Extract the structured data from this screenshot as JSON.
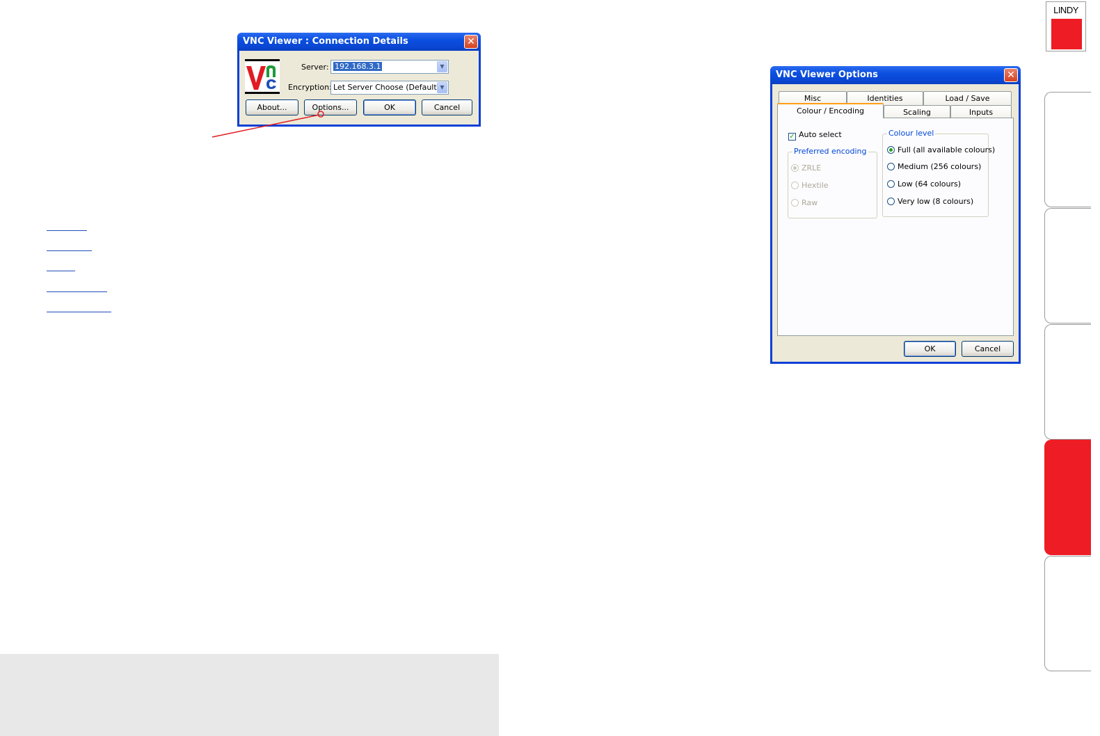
{
  "connection_dialog": {
    "title": "VNC Viewer : Connection Details",
    "server_label": "Server:",
    "server_value": "192.168.3.1",
    "encryption_label": "Encryption:",
    "encryption_value": "Let Server Choose (Default)",
    "buttons": {
      "about": "About...",
      "options": "Options...",
      "ok": "OK",
      "cancel": "Cancel"
    }
  },
  "options_dialog": {
    "title": "VNC Viewer Options",
    "tabs_back": [
      "Misc",
      "Identities",
      "Load / Save"
    ],
    "tabs_front": [
      "Colour / Encoding",
      "Scaling",
      "Inputs"
    ],
    "active_tab": "Colour / Encoding",
    "auto_select": {
      "label": "Auto select",
      "checked": true
    },
    "preferred_encoding": {
      "title": "Preferred encoding",
      "options": [
        "ZRLE",
        "Hextile",
        "Raw"
      ],
      "selected": "ZRLE"
    },
    "colour_level": {
      "title": "Colour level",
      "options": [
        "Full (all available colours)",
        "Medium (256 colours)",
        "Low (64 colours)",
        "Very low (8 colours)"
      ],
      "selected": "Full (all available colours)"
    },
    "buttons": {
      "ok": "OK",
      "cancel": "Cancel"
    }
  },
  "brand": {
    "logo_text": "LINDY",
    "accent_color": "#ee1c25"
  }
}
